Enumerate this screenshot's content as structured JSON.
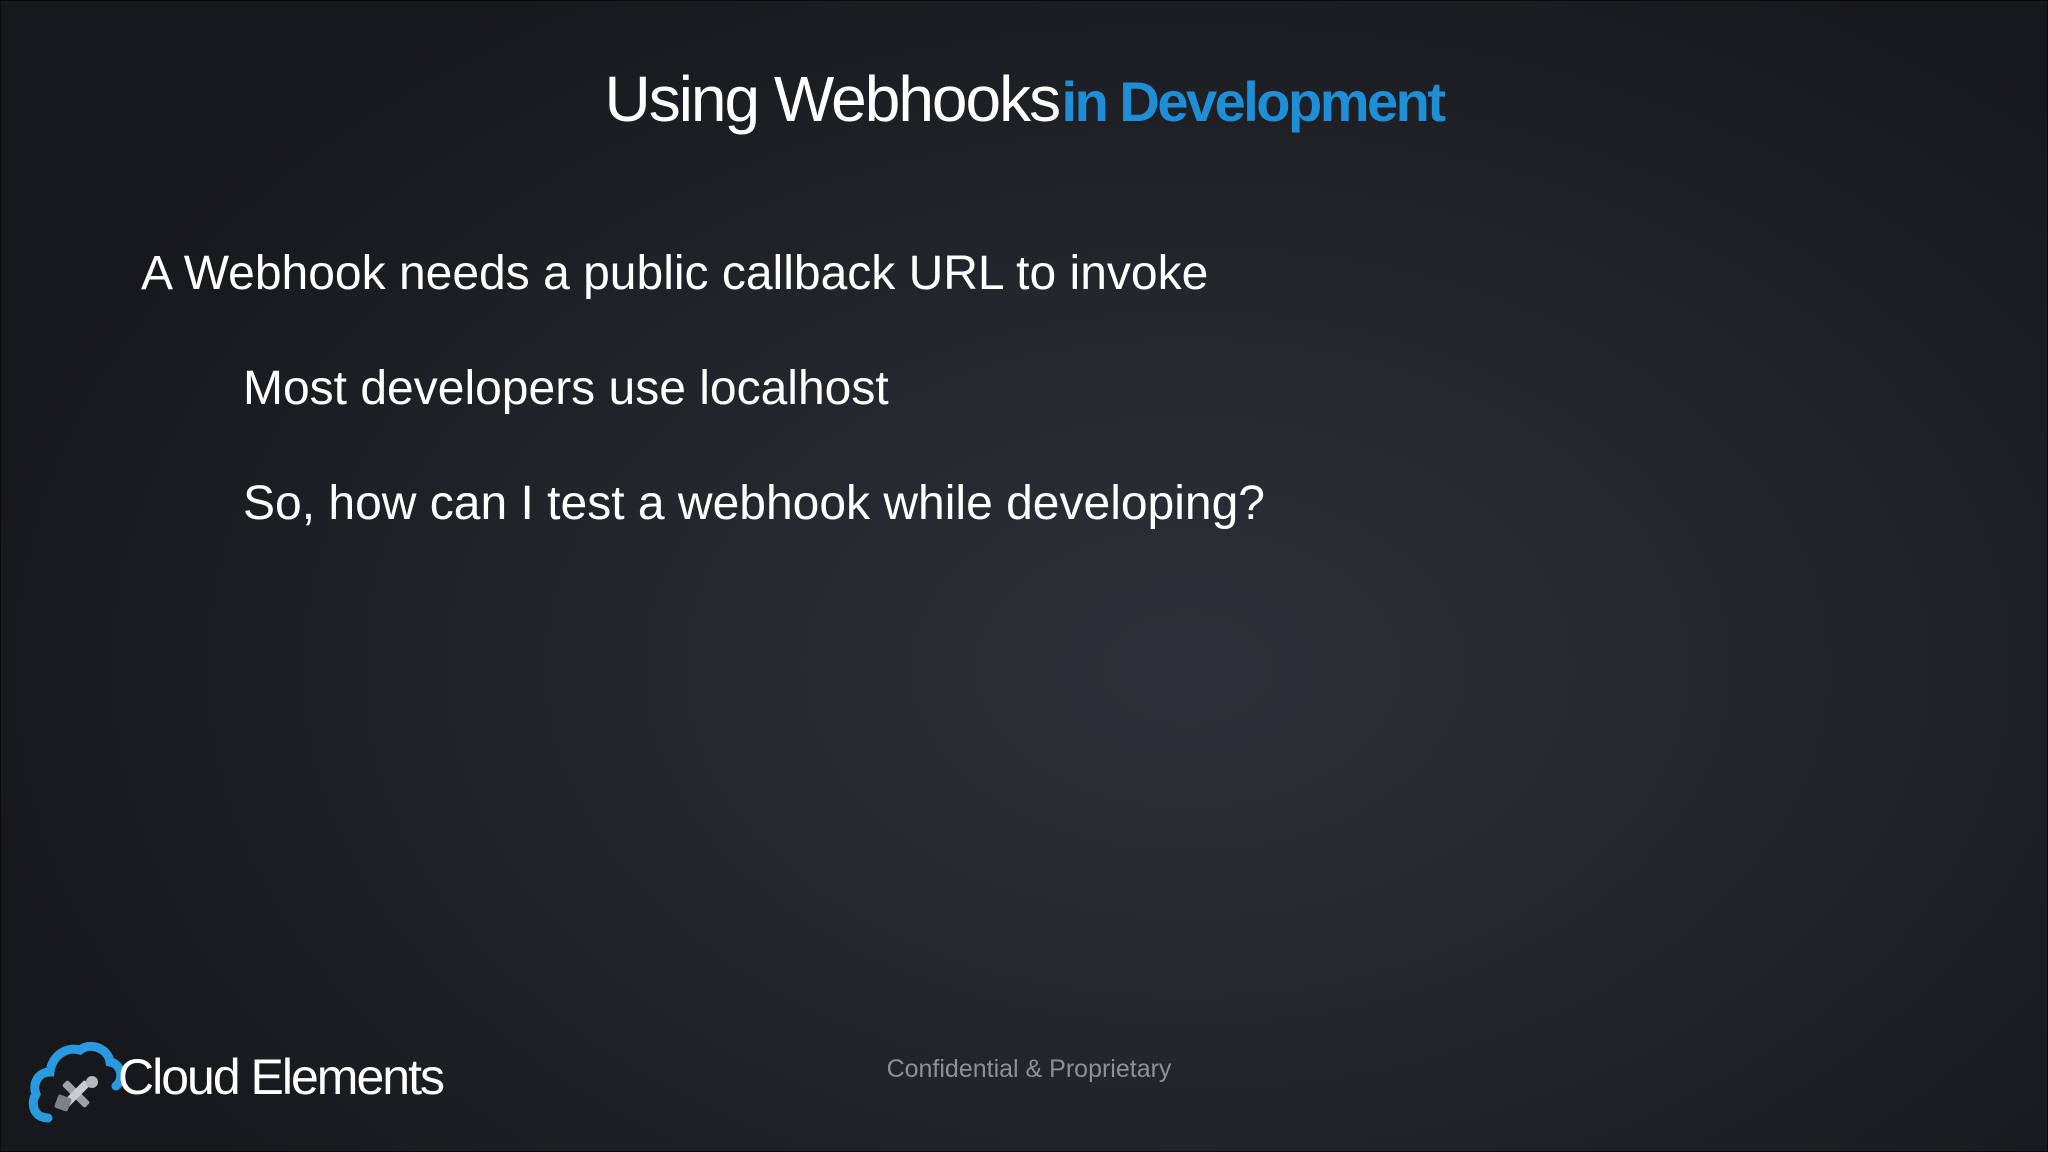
{
  "slide": {
    "title_main": "Using Webhooks",
    "title_accent": "in Development",
    "bullets": [
      "A Webhook needs a public callback URL to invoke",
      "Most developers use localhost",
      "So, how can I test a webhook while developing?"
    ],
    "footer": "Confidential & Proprietary"
  },
  "logo": {
    "name": "Cloud Elements",
    "icon": "cloud-elements-logo-icon"
  },
  "colors": {
    "accent": "#1e8fd6",
    "background": "#26292f",
    "text": "#ffffff",
    "footer_text": "#8d9097"
  }
}
